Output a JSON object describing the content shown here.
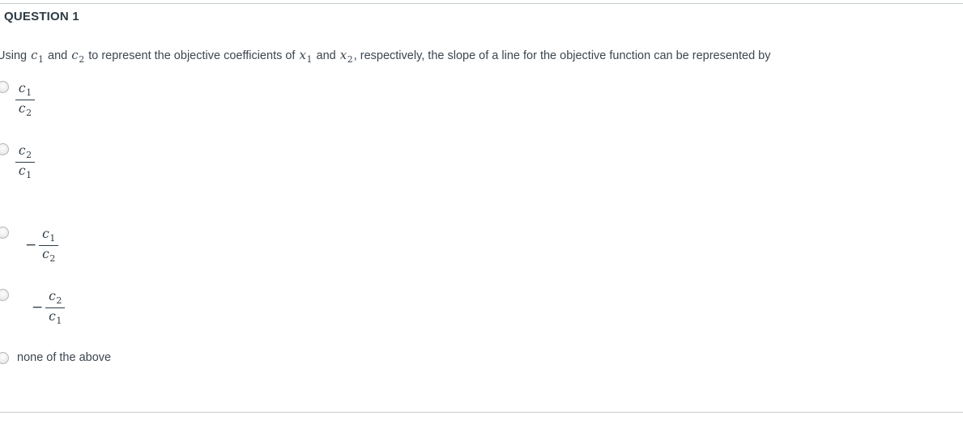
{
  "question": {
    "header": "QUESTION 1",
    "prompt_part_1": "Using",
    "var_c1": "c",
    "var_c1_sub": "1",
    "prompt_part_2": "and",
    "var_c2": "c",
    "var_c2_sub": "2",
    "prompt_part_3": "to represent the objective coefficients of",
    "var_x1": "x",
    "var_x1_sub": "1",
    "prompt_part_4": "and",
    "var_x2": "x",
    "var_x2_sub": "2",
    "prompt_part_5": ", respectively, the slope of a line for the objective function can be represented by"
  },
  "options": [
    {
      "id": "option-1",
      "type": "fraction",
      "sign": "",
      "numerator": "c",
      "numerator_sub": "1",
      "denominator": "c",
      "denominator_sub": "2",
      "selected": false
    },
    {
      "id": "option-2",
      "type": "fraction",
      "sign": "",
      "numerator": "c",
      "numerator_sub": "2",
      "denominator": "c",
      "denominator_sub": "1",
      "selected": false
    },
    {
      "id": "option-3",
      "type": "fraction",
      "sign": "−",
      "numerator": "c",
      "numerator_sub": "1",
      "denominator": "c",
      "denominator_sub": "2",
      "selected": false
    },
    {
      "id": "option-4",
      "type": "fraction",
      "sign": "−",
      "numerator": "c",
      "numerator_sub": "2",
      "denominator": "c",
      "denominator_sub": "1",
      "selected": false
    },
    {
      "id": "option-5",
      "type": "text",
      "label": "none of the above",
      "selected": false
    }
  ],
  "colors": {
    "rule": "#c7cdd1",
    "heading_text": "#2d3b45",
    "body_text": "#3c4650",
    "radio_border": "#b6b6b6"
  }
}
